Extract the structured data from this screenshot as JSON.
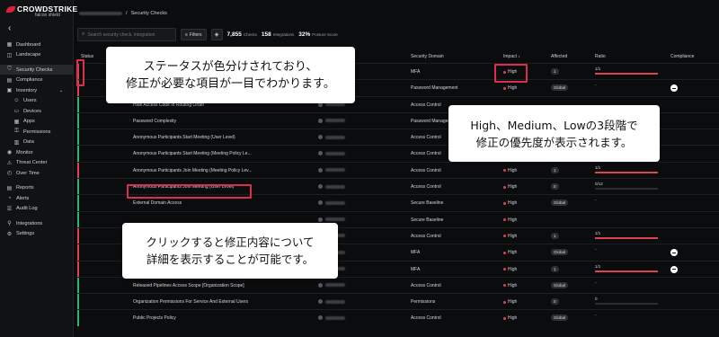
{
  "brand": {
    "name": "CROWDSTRIKE",
    "sub": "falcon shield"
  },
  "breadcrumb": {
    "current": "Security Checks"
  },
  "sidebar": {
    "items": [
      {
        "label": "Dashboard",
        "icon": "grid-icon"
      },
      {
        "label": "Landscape",
        "icon": "layers-icon"
      },
      {
        "label": "Security Checks",
        "icon": "shield-icon",
        "active": true
      },
      {
        "label": "Compliance",
        "icon": "clipboard-icon"
      },
      {
        "label": "Inventory",
        "icon": "box-icon"
      },
      {
        "label": "Users",
        "icon": "user-icon",
        "sub": true
      },
      {
        "label": "Devices",
        "icon": "device-icon",
        "sub": true
      },
      {
        "label": "Apps",
        "icon": "apps-icon",
        "sub": true
      },
      {
        "label": "Permissions",
        "icon": "key-icon",
        "sub": true
      },
      {
        "label": "Data",
        "icon": "data-icon",
        "sub": true
      },
      {
        "label": "Monitor",
        "icon": "monitor-icon"
      },
      {
        "label": "Threat Center",
        "icon": "alert-icon"
      },
      {
        "label": "Over Time",
        "icon": "clock-icon"
      },
      {
        "label": "Reports",
        "icon": "report-icon"
      },
      {
        "label": "Alerts",
        "icon": "bell-icon"
      },
      {
        "label": "Audit Log",
        "icon": "log-icon"
      },
      {
        "label": "Integrations",
        "icon": "plug-icon"
      },
      {
        "label": "Settings",
        "icon": "gear-icon"
      }
    ]
  },
  "toolbar": {
    "search_placeholder": "Search security check, integration",
    "filters_label": "Filters",
    "checks_count": "7,855",
    "checks_label": "Checks",
    "integrations_count": "158",
    "integrations_label": "Integrations",
    "posture_score": "32%",
    "posture_label": "Posture Score"
  },
  "table": {
    "headers": {
      "status": "Status",
      "domain": "Security Domain",
      "impact": "Impact ↓",
      "affected": "Affected",
      "ratio": "Ratio",
      "compliance": "Compliance"
    },
    "rows": [
      {
        "status": "#e0424f",
        "name": "",
        "domain": "MFA",
        "impact": "High",
        "affected": "1",
        "ratio": "1/1",
        "ratio_fill": 1.0,
        "comp": false
      },
      {
        "status": "#e0424f",
        "name": "",
        "domain": "Password Management",
        "impact": "High",
        "affected": "Global",
        "ratio": "-",
        "ratio_fill": 0,
        "comp": true
      },
      {
        "status": "#2bb673",
        "name": "Hide Access Code In Routing Order",
        "domain": "Access Control",
        "impact": "",
        "affected": "",
        "ratio": "",
        "ratio_fill": 0,
        "comp": false
      },
      {
        "status": "#2bb673",
        "name": "Password Complexity",
        "domain": "Password Management",
        "impact": "",
        "affected": "",
        "ratio": "",
        "ratio_fill": 0,
        "comp": false
      },
      {
        "status": "#2bb673",
        "name": "Anonymous Participants Start Meeting (User Level)",
        "domain": "Access Control",
        "impact": "",
        "affected": "",
        "ratio": "",
        "ratio_fill": 0,
        "comp": false
      },
      {
        "status": "#2bb673",
        "name": "Anonymous Participants Start Meeting (Meeting Policy Le...",
        "domain": "Access Control",
        "impact": "",
        "affected": "",
        "ratio": "",
        "ratio_fill": 0,
        "comp": false
      },
      {
        "status": "#e0424f",
        "name": "Anonymous Participants Join Meeting (Meeting Policy Lev...",
        "domain": "Access Control",
        "impact": "High",
        "affected": "1",
        "ratio": "1/1",
        "ratio_fill": 1.0,
        "comp": false
      },
      {
        "status": "#2bb673",
        "name": "Anonymous Participants Join Meeting (User Level)",
        "domain": "Access Control",
        "impact": "High",
        "affected": "0",
        "ratio": "0/12",
        "ratio_fill": 0,
        "comp": false
      },
      {
        "status": "#2bb673",
        "name": "External Domain Access",
        "domain": "Secure Baseline",
        "impact": "High",
        "affected": "Global",
        "ratio": "-",
        "ratio_fill": 0,
        "comp": false
      },
      {
        "status": "#2bb673",
        "name": "",
        "domain": "Secure Baseline",
        "impact": "High",
        "affected": "",
        "ratio": "",
        "ratio_fill": 0,
        "comp": false
      },
      {
        "status": "#e0424f",
        "name": "",
        "domain": "Access Control",
        "impact": "High",
        "affected": "1",
        "ratio": "1/1",
        "ratio_fill": 1.0,
        "comp": false
      },
      {
        "status": "#e0424f",
        "name": "",
        "domain": "MFA",
        "impact": "High",
        "affected": "Global",
        "ratio": "-",
        "ratio_fill": 0,
        "comp": true
      },
      {
        "status": "#e0424f",
        "name": "",
        "domain": "MFA",
        "impact": "High",
        "affected": "1",
        "ratio": "1/1",
        "ratio_fill": 1.0,
        "comp": true
      },
      {
        "status": "#2bb673",
        "name": "Released Pipelines Access Scope [Organization Scope]",
        "domain": "Access Control",
        "impact": "High",
        "affected": "Global",
        "ratio": "-",
        "ratio_fill": 0,
        "comp": false
      },
      {
        "status": "#2bb673",
        "name": "Organization Permissions For Service And External Users",
        "domain": "Permissions",
        "impact": "High",
        "affected": "0",
        "ratio": "0",
        "ratio_fill": 0,
        "comp": false
      },
      {
        "status": "#2bb673",
        "name": "Public Projects Policy",
        "domain": "Access Control",
        "impact": "High",
        "affected": "Global",
        "ratio": "-",
        "ratio_fill": 0,
        "comp": false
      }
    ]
  },
  "callouts": {
    "status": "ステータスが色分けされており、\n修正が必要な項目が一目でわかります。",
    "impact": "High、Medium、Lowの3段階で\n修正の優先度が表示されます。",
    "click": "クリックすると修正内容について\n詳細を表示することが可能です。"
  },
  "colors": {
    "accent": "#d92e50",
    "high": "#e0424f",
    "ok": "#2bb673"
  }
}
